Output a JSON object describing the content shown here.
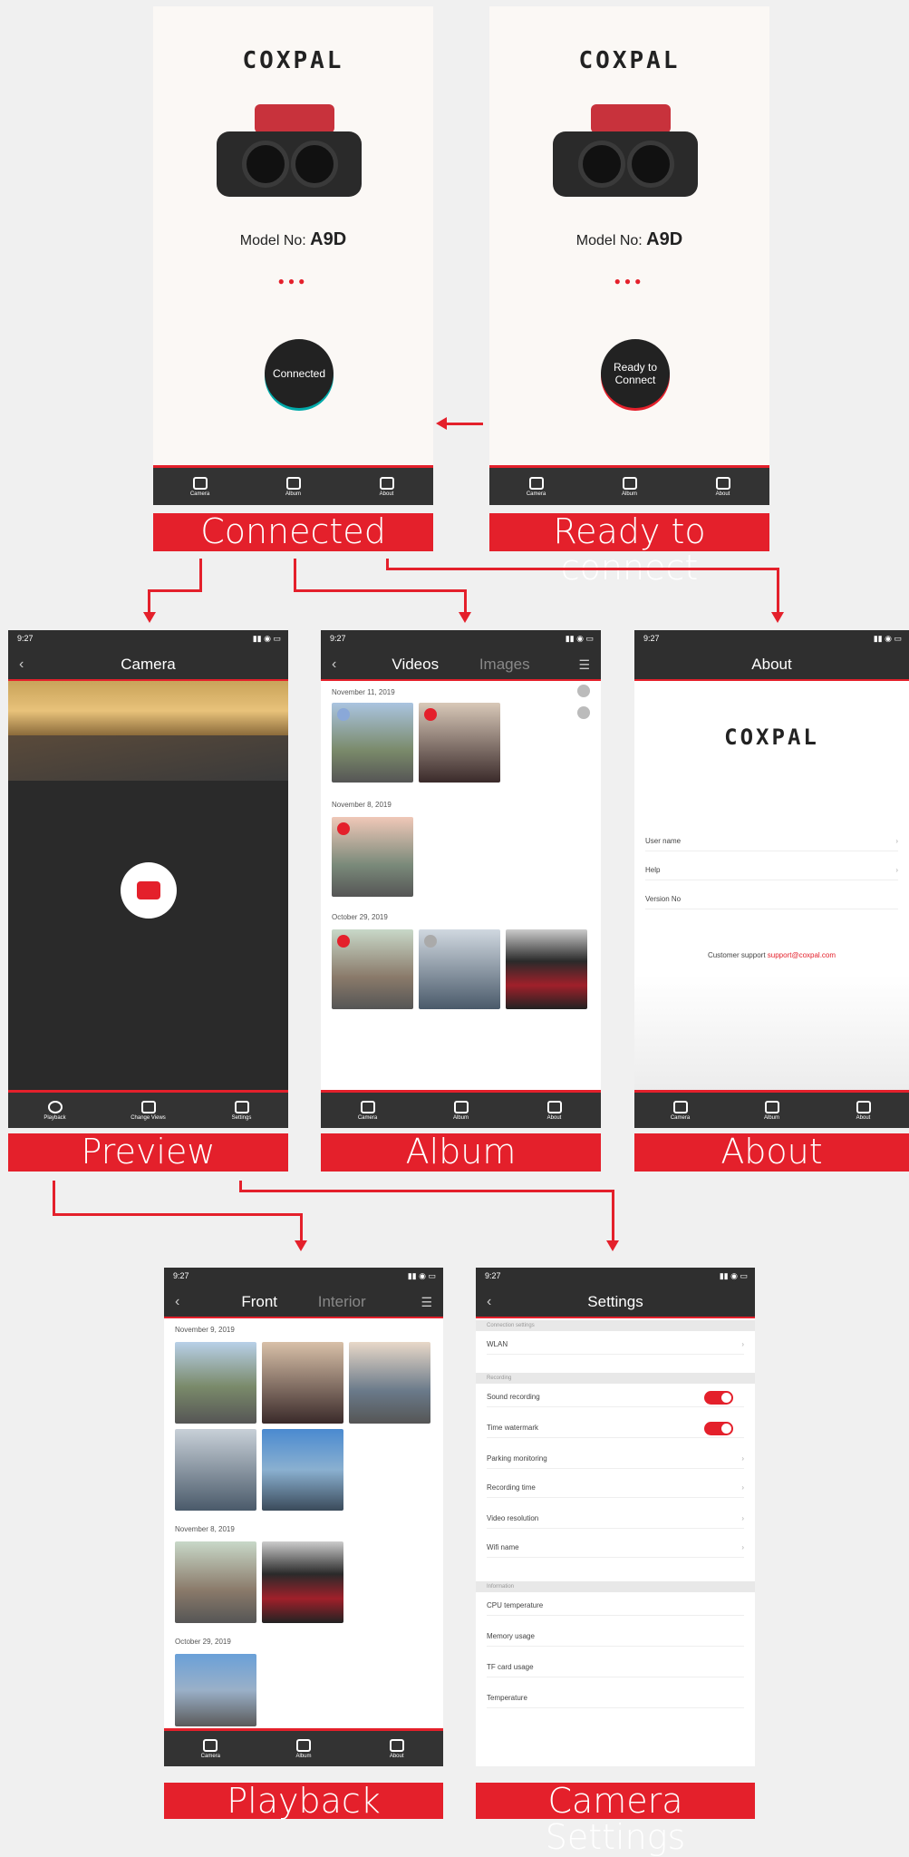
{
  "brand": "COXPAL",
  "model": {
    "prefix": "Model No:",
    "value": "A9D"
  },
  "dots": "●●●",
  "screens": {
    "connected": {
      "status": "Connected",
      "caption": "Connected"
    },
    "ready": {
      "status_line1": "Ready to",
      "status_line2": "Connect",
      "caption": "Ready to connect"
    },
    "preview": {
      "caption": "Preview",
      "title": "Camera",
      "tabs": [
        "Playback",
        "Change Views",
        "Settings"
      ]
    },
    "album": {
      "caption": "Album",
      "tab_videos": "Videos",
      "tab_images": "Images",
      "dates": [
        "November 11, 2019",
        "November 8, 2019",
        "October 29, 2019"
      ]
    },
    "about": {
      "caption": "About",
      "title": "About",
      "rows": [
        "User name",
        "Help",
        "Version No"
      ],
      "support_prefix": "Customer support",
      "support_link": "support@coxpal.com"
    },
    "playback": {
      "caption": "Playback",
      "tab_front": "Front",
      "tab_interior": "Interior",
      "dates": [
        "November 9, 2019",
        "November 8, 2019",
        "October 29, 2019"
      ]
    },
    "settings": {
      "caption": "Camera Settings",
      "title": "Settings",
      "sections": [
        "Connection settings",
        "Recording",
        "Information"
      ],
      "wifi": "WLAN",
      "recording_rows": [
        "Sound recording",
        "Time watermark",
        "Parking monitoring",
        "Recording time",
        "Video resolution",
        "Wifi name"
      ],
      "info_rows": [
        "CPU temperature",
        "Memory usage",
        "TF card usage",
        "Temperature"
      ]
    }
  },
  "tabbar": [
    "Camera",
    "Album",
    "About"
  ],
  "status_time": "9:27",
  "colors": {
    "accent": "#e4202b",
    "dark": "#2f2f2f"
  }
}
